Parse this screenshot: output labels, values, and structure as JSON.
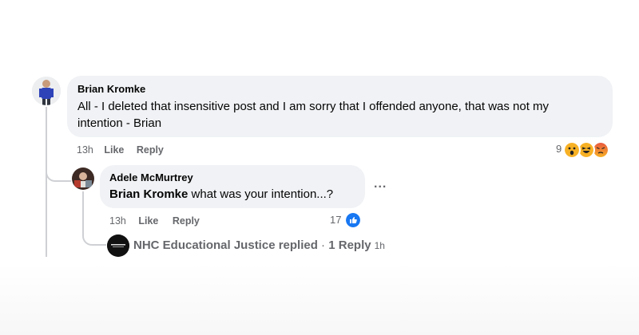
{
  "comment": {
    "author": "Brian Kromke",
    "text": "All - I deleted that insensitive post and I am sorry that I offended anyone, that was not my intention - Brian",
    "time": "13h",
    "like_label": "Like",
    "reply_label": "Reply",
    "reaction_count": "9",
    "reaction_icons": [
      "wow-icon",
      "haha-icon",
      "angry-icon"
    ],
    "colors": {
      "bubble": "#f0f2f5",
      "meta": "#65676b",
      "like_blue": "#1877f2"
    }
  },
  "reply": {
    "author": "Adele McMurtrey",
    "mention": "Brian Kromke",
    "text": " what was your intention...?",
    "time": "13h",
    "like_label": "Like",
    "reply_label": "Reply",
    "reaction_count": "17",
    "reaction_icon": "like-icon",
    "more_label": "..."
  },
  "nested": {
    "name": "NHC Educational Justice replied",
    "separator": " · ",
    "count_label": "1 Reply",
    "time": "1h"
  }
}
